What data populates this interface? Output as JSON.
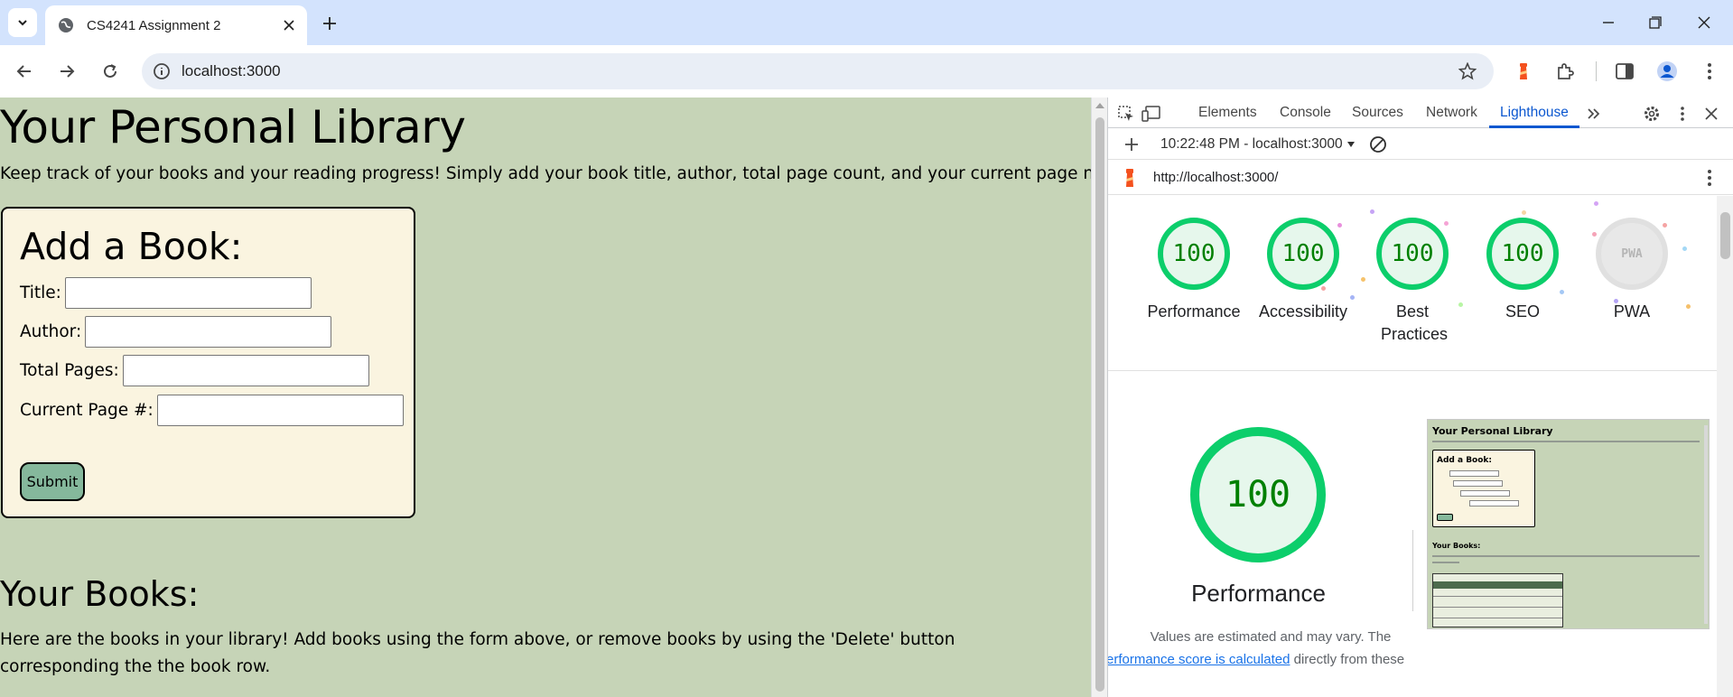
{
  "browser": {
    "tab_title": "CS4241 Assignment 2",
    "url": "localhost:3000"
  },
  "page": {
    "title": "Your Personal Library",
    "intro": "Keep track of your books and your reading progress! Simply add your book title, author, total page count, and your current page number.",
    "form": {
      "title": "Add a Book:",
      "title_label": "Title:",
      "author_label": "Author:",
      "total_pages_label": "Total Pages:",
      "current_page_label": "Current Page #:",
      "submit_label": "Submit"
    },
    "books_title": "Your Books:",
    "books_description": "Here are the books in your library! Add books using the form above, or remove books by using the 'Delete' button corresponding the the book row."
  },
  "devtools": {
    "tabs": [
      "Elements",
      "Console",
      "Sources",
      "Network",
      "Lighthouse"
    ],
    "active_tab": "Lighthouse",
    "session": "10:22:48 PM - localhost:3000",
    "report_url": "http://localhost:3000/",
    "scores": [
      {
        "label": "Performance",
        "value": "100"
      },
      {
        "label": "Accessibility",
        "value": "100"
      },
      {
        "label": "Best Practices",
        "value": "100"
      },
      {
        "label": "SEO",
        "value": "100"
      },
      {
        "label": "PWA",
        "value": "PWA"
      }
    ],
    "main_score": "100",
    "main_label": "Performance",
    "estimate_text": "Values are estimated and may vary. The",
    "calc_link": "erformance score is calculated",
    "calc_suffix": "directly from these",
    "thumbnail": {
      "title": "Your Personal Library",
      "form_title": "Add a Book:",
      "books_title": "Your Books:"
    }
  },
  "colors": {
    "page_bg": "#c6d4b7",
    "form_bg": "#faf4e0",
    "submit_bg": "#85b89c",
    "score_green": "#0cce6b",
    "devtools_accent": "#0b57d0"
  }
}
